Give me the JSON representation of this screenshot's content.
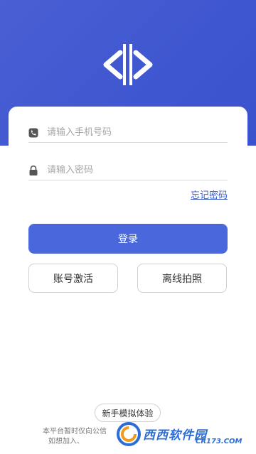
{
  "login": {
    "phone_placeholder": "请输入手机号码",
    "password_placeholder": "请输入密码",
    "forgot_password": "忘记密码",
    "login_button": "登录",
    "activate_account": "账号激活",
    "offline_photo": "离线拍照"
  },
  "footer": {
    "trial_button": "新手模拟体验",
    "note_line1": "本平台暂时仅向公信",
    "note_line2": "如想加入、"
  },
  "watermark": {
    "text": "西西软件园",
    "sub": "CR173.COM"
  },
  "colors": {
    "brand_blue": "#4a68dc",
    "link_blue": "#3c5fc9"
  },
  "icons": {
    "logo": "code-brackets-logo",
    "phone": "phone-icon",
    "lock": "lock-icon"
  }
}
